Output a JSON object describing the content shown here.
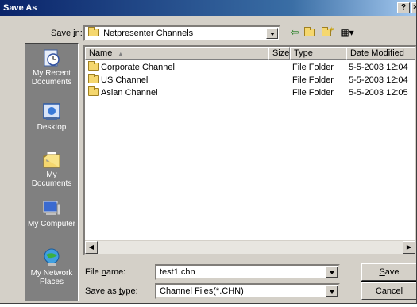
{
  "window": {
    "title": "Save As",
    "help": "?",
    "close": "×"
  },
  "save_in": {
    "label_pre": "Save ",
    "label_u": "i",
    "label_post": "n:",
    "value": "Netpresenter Channels"
  },
  "toolbar": {
    "back_icon": "arrow-left-icon",
    "up_icon": "folder-up-icon",
    "new_folder_icon": "new-folder-icon",
    "views_icon": "views-menu-icon"
  },
  "places": [
    {
      "label1": "My Recent",
      "label2": "Documents",
      "icon": "recent-documents-icon"
    },
    {
      "label1": "Desktop",
      "label2": "",
      "icon": "desktop-icon"
    },
    {
      "label1": "My Documents",
      "label2": "",
      "icon": "my-documents-icon"
    },
    {
      "label1": "My Computer",
      "label2": "",
      "icon": "my-computer-icon"
    },
    {
      "label1": "My Network",
      "label2": "Places",
      "icon": "network-places-icon"
    }
  ],
  "columns": {
    "name": "Name",
    "size": "Size",
    "type": "Type",
    "modified": "Date Modified",
    "sort_indicator": "▲"
  },
  "files": [
    {
      "name": "Corporate Channel",
      "size": "",
      "type": "File Folder",
      "modified": "5-5-2003 12:04"
    },
    {
      "name": "US Channel",
      "size": "",
      "type": "File Folder",
      "modified": "5-5-2003 12:04"
    },
    {
      "name": "Asian Channel",
      "size": "",
      "type": "File Folder",
      "modified": "5-5-2003 12:05"
    }
  ],
  "file_name": {
    "label_pre": "File ",
    "label_u": "n",
    "label_post": "ame:",
    "value": "test1.chn"
  },
  "save_as_type": {
    "label_pre": "Save as ",
    "label_u": "t",
    "label_post": "ype:",
    "value": "Channel Files(*.CHN)"
  },
  "buttons": {
    "save_u": "S",
    "save_rest": "ave",
    "cancel": "Cancel"
  },
  "scroll": {
    "left": "◀",
    "right": "▶"
  },
  "colors": {
    "titlebar_start": "#0a246a",
    "titlebar_end": "#a6caf0",
    "dialog_bg": "#d4d0c8",
    "places_bg": "#808080"
  }
}
